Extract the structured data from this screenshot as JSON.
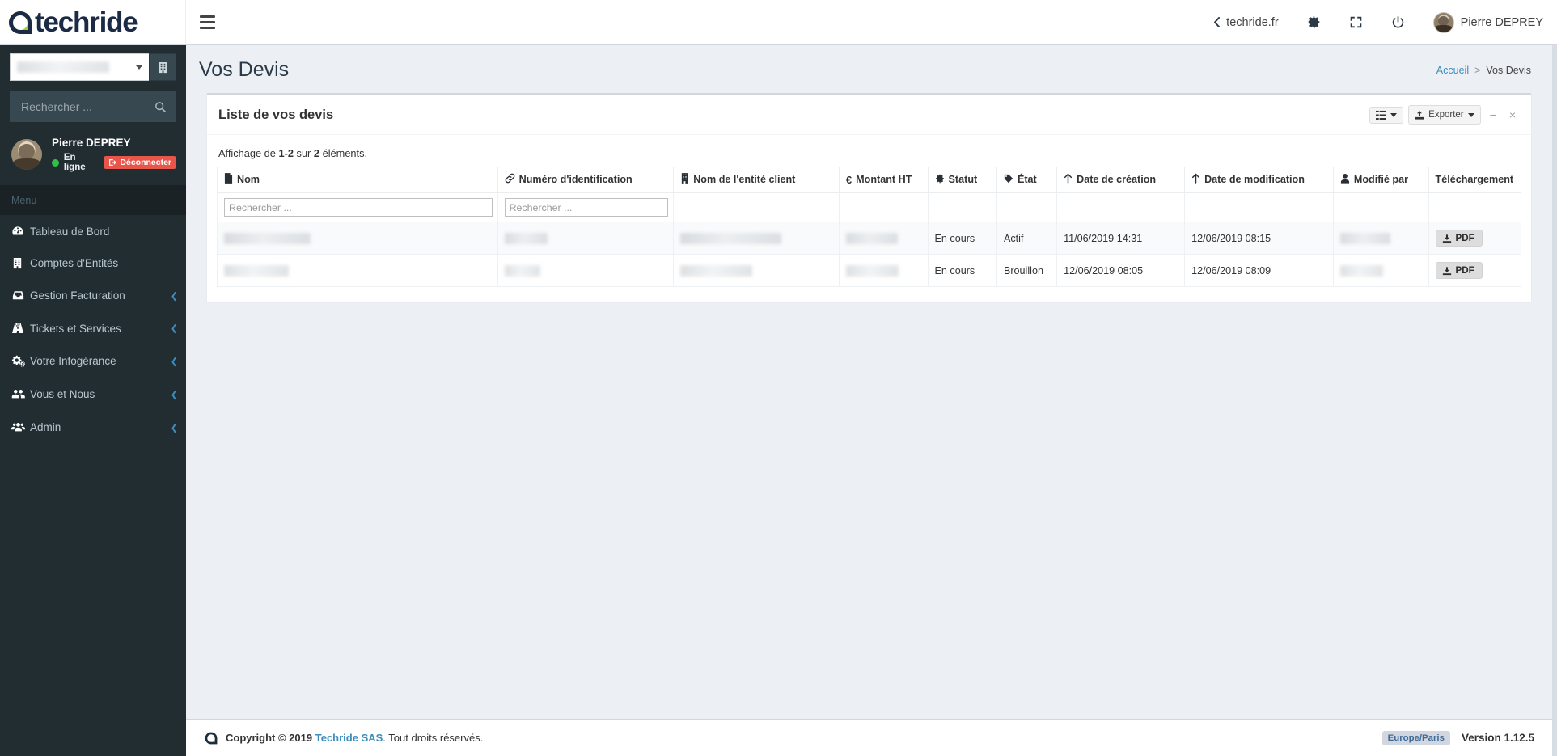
{
  "brand": {
    "logo_text": "techride",
    "accent_green": "#aacc33",
    "accent_dark": "#1b2b46"
  },
  "topbar": {
    "menu_toggle": "hamburger-menu",
    "site_link": "techride.fr",
    "settings_icon": "gear-icon",
    "fullscreen_icon": "expand-icon",
    "power_icon": "power-icon",
    "user_name": "Pierre DEPREY"
  },
  "sidebar": {
    "entity_select": {
      "value": "█████  ████████",
      "redacted": true
    },
    "entity_button_icon": "building-icon",
    "search": {
      "placeholder": "Rechercher ...",
      "value": "",
      "icon": "search-icon"
    },
    "user": {
      "name": "Pierre DEPREY",
      "status": "En ligne",
      "logout_label": "Déconnecter"
    },
    "menu_header": "Menu",
    "items": [
      {
        "label": "Tableau de Bord",
        "icon": "dashboard-icon",
        "has_arrow": false
      },
      {
        "label": "Comptes d'Entités",
        "icon": "building-icon",
        "has_arrow": false
      },
      {
        "label": "Gestion Facturation",
        "icon": "inbox-icon",
        "has_arrow": true
      },
      {
        "label": "Tickets et Services",
        "icon": "road-icon",
        "has_arrow": true
      },
      {
        "label": "Votre Infogérance",
        "icon": "cogs-icon",
        "has_arrow": true
      },
      {
        "label": "Vous et Nous",
        "icon": "users-icon",
        "has_arrow": true
      },
      {
        "label": "Admin",
        "icon": "user-group-icon",
        "has_arrow": true
      }
    ]
  },
  "page": {
    "title": "Vos Devis",
    "breadcrumb": {
      "home": "Accueil",
      "separator": ">",
      "current": "Vos Devis"
    }
  },
  "card": {
    "title": "Liste de vos devis",
    "tools": {
      "columns_icon": "list-columns-icon",
      "export_label": "Exporter",
      "export_icon": "export-icon",
      "minimize_icon": "minimize-icon",
      "close_icon": "close-icon"
    },
    "showing_prefix": "Affichage de",
    "showing_range": "1-2",
    "showing_middle": "sur",
    "showing_total": "2",
    "showing_suffix": "éléments."
  },
  "table": {
    "columns": [
      {
        "label": "Nom",
        "icon": "file-icon"
      },
      {
        "label": "Numéro d'identification",
        "icon": "link-icon"
      },
      {
        "label": "Nom de l'entité client",
        "icon": "building-icon"
      },
      {
        "label": "Montant HT",
        "icon": "euro-icon"
      },
      {
        "label": "Statut",
        "icon": "gear-icon"
      },
      {
        "label": "État",
        "icon": "tag-icon"
      },
      {
        "label": "Date de création",
        "icon": "arrow-up-icon"
      },
      {
        "label": "Date de modification",
        "icon": "arrow-up-icon"
      },
      {
        "label": "Modifié par",
        "icon": "user-icon"
      },
      {
        "label": "Téléchargement",
        "icon": ""
      }
    ],
    "filters": {
      "nom_placeholder": "Rechercher ...",
      "numero_placeholder": "Rechercher ..."
    },
    "rows": [
      {
        "nom": "████████████",
        "nom_redacted": true,
        "numero": "██████",
        "numero_redacted": true,
        "entite": "██████████████",
        "entite_redacted": true,
        "montant": "████,00 €",
        "montant_redacted": true,
        "statut": "En cours",
        "etat": "Actif",
        "date_creation": "11/06/2019 14:31",
        "date_modification": "12/06/2019 08:15",
        "modifie_par": "███████",
        "modifie_par_redacted": true,
        "download_label": "PDF"
      },
      {
        "nom": "█████████",
        "nom_redacted": true,
        "numero": "█████",
        "numero_redacted": true,
        "entite": "██████████",
        "entite_redacted": true,
        "montant": "5 ███,00 €",
        "montant_redacted": true,
        "statut": "En cours",
        "etat": "Brouillon",
        "date_creation": "12/06/2019 08:05",
        "date_modification": "12/06/2019 08:09",
        "modifie_par": "██████",
        "modifie_par_redacted": true,
        "download_label": "PDF"
      }
    ]
  },
  "footer": {
    "copyright_prefix": "Copyright © 2019",
    "company": "Techride SAS",
    "copyright_suffix": ". Tout droits réservés.",
    "timezone": "Europe/Paris",
    "version": "Version 1.12.5"
  }
}
